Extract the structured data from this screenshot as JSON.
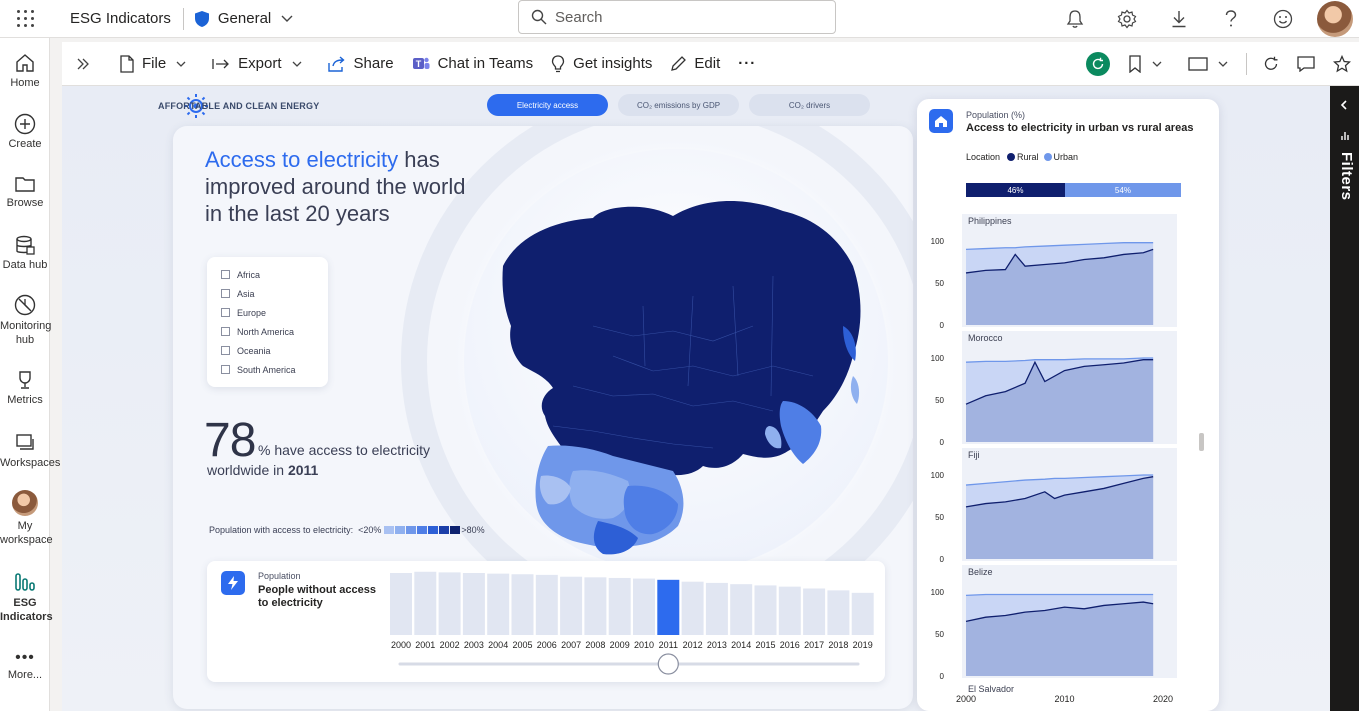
{
  "app": {
    "title": "ESG Indicators",
    "workspace": "General"
  },
  "search": {
    "placeholder": "Search"
  },
  "rail": [
    {
      "label": "Home",
      "icon": "home-icon"
    },
    {
      "label": "Create",
      "icon": "plus-circle-icon"
    },
    {
      "label": "Browse",
      "icon": "folder-icon"
    },
    {
      "label": "Data hub",
      "icon": "database-icon"
    },
    {
      "label": "Monitoring",
      "label2": "hub",
      "icon": "monitoring-icon"
    },
    {
      "label": "Metrics",
      "icon": "trophy-icon"
    },
    {
      "label": "Workspaces",
      "icon": "workspaces-icon"
    },
    {
      "label": "My",
      "label2": "workspace",
      "icon": "avatar"
    },
    {
      "label": "ESG",
      "label2": "Indicators",
      "icon": "bar-chart-icon"
    },
    {
      "label": "More...",
      "icon": "more-icon"
    }
  ],
  "toolbar": {
    "file": "File",
    "export": "Export",
    "share": "Share",
    "chat": "Chat in Teams",
    "insights": "Get insights",
    "edit": "Edit",
    "more": "···"
  },
  "filters": {
    "label": "Filters"
  },
  "report": {
    "section_title": "AFFORTABLE AND CLEAN ENERGY",
    "tabs": [
      {
        "label": "Electricity access",
        "active": true
      },
      {
        "label": "CO₂ emissions by GDP",
        "active": false
      },
      {
        "label": "CO₂ drivers",
        "active": false
      }
    ],
    "headline_highlight": "Access to electricity",
    "headline_rest1": " has",
    "headline_line2": "improved around the world",
    "headline_line3": "in the last 20 years",
    "regions": [
      "Africa",
      "Asia",
      "Europe",
      "North America",
      "Oceania",
      "South America"
    ],
    "big_number": "78",
    "big_number_desc": "% have access to electricity",
    "big_number_desc2_prefix": "worldwide in ",
    "big_number_year": "2011",
    "legend_label": "Population with access to electricity:",
    "legend_low": "<20%",
    "legend_high": ">80%",
    "legend_colors": [
      "#a9c1f2",
      "#8fb0ef",
      "#6f97ea",
      "#4f7ee6",
      "#2d5fd6",
      "#1c3fa8",
      "#0f2370"
    ],
    "colors": {
      "accent": "#2d6bee",
      "dark": "#0f1f6e"
    }
  },
  "population_card": {
    "subtitle": "Population",
    "title": "People without access to electricity",
    "selected_year": "2011",
    "years": [
      "2000",
      "2001",
      "2002",
      "2003",
      "2004",
      "2005",
      "2006",
      "2007",
      "2008",
      "2009",
      "2010",
      "2011",
      "2012",
      "2013",
      "2014",
      "2015",
      "2016",
      "2017",
      "2018",
      "2019"
    ],
    "values": [
      1.0,
      1.02,
      1.01,
      1.0,
      0.99,
      0.98,
      0.97,
      0.94,
      0.93,
      0.92,
      0.91,
      0.89,
      0.86,
      0.84,
      0.82,
      0.8,
      0.78,
      0.75,
      0.72,
      0.68
    ]
  },
  "urban_rural": {
    "subtitle": "Population (%)",
    "title": "Access to electricity in urban vs rural areas",
    "legend_title": "Location",
    "legend": [
      {
        "name": "Rural",
        "color": "#0f1f6e"
      },
      {
        "name": "Urban",
        "color": "#6f97ea"
      }
    ],
    "split": [
      {
        "label": "46%",
        "value": 46,
        "color": "#0f1f6e"
      },
      {
        "label": "54%",
        "value": 54,
        "color": "#6f97ea"
      }
    ],
    "y_ticks": [
      "100",
      "50",
      "0"
    ],
    "x_ticks": [
      "2000",
      "2010",
      "2020"
    ]
  },
  "chart_data": [
    {
      "type": "area",
      "title": "Philippines",
      "x": [
        2000,
        2002,
        2004,
        2005,
        2006,
        2008,
        2010,
        2012,
        2014,
        2016,
        2018,
        2019
      ],
      "series": [
        {
          "name": "Urban",
          "values": [
            90,
            91,
            92,
            92,
            93,
            94,
            95,
            96,
            97,
            98,
            98,
            98
          ]
        },
        {
          "name": "Rural",
          "values": [
            62,
            65,
            66,
            84,
            70,
            72,
            74,
            78,
            80,
            84,
            86,
            90
          ]
        }
      ],
      "ylim": [
        0,
        100
      ]
    },
    {
      "type": "area",
      "title": "Morocco",
      "x": [
        2000,
        2002,
        2004,
        2006,
        2007,
        2008,
        2010,
        2012,
        2014,
        2016,
        2018,
        2019
      ],
      "series": [
        {
          "name": "Urban",
          "values": [
            95,
            96,
            96,
            97,
            98,
            98,
            98,
            99,
            99,
            99,
            100,
            100
          ]
        },
        {
          "name": "Rural",
          "values": [
            45,
            55,
            60,
            70,
            95,
            72,
            85,
            90,
            92,
            94,
            98,
            98
          ]
        }
      ],
      "ylim": [
        0,
        100
      ]
    },
    {
      "type": "area",
      "title": "Fiji",
      "x": [
        2000,
        2002,
        2004,
        2006,
        2008,
        2009,
        2010,
        2012,
        2014,
        2016,
        2018,
        2019
      ],
      "series": [
        {
          "name": "Urban",
          "values": [
            88,
            90,
            92,
            94,
            95,
            96,
            96,
            97,
            98,
            99,
            100,
            100
          ]
        },
        {
          "name": "Rural",
          "values": [
            62,
            66,
            68,
            72,
            80,
            72,
            76,
            80,
            84,
            90,
            96,
            98
          ]
        }
      ],
      "ylim": [
        0,
        100
      ]
    },
    {
      "type": "area",
      "title": "Belize",
      "x": [
        2000,
        2002,
        2004,
        2006,
        2008,
        2010,
        2012,
        2014,
        2016,
        2018,
        2019
      ],
      "series": [
        {
          "name": "Urban",
          "values": [
            96,
            97,
            97,
            97,
            97,
            97,
            97,
            97,
            97,
            97,
            97
          ]
        },
        {
          "name": "Rural",
          "values": [
            65,
            70,
            72,
            76,
            78,
            82,
            80,
            84,
            86,
            88,
            86
          ]
        }
      ],
      "ylim": [
        0,
        100
      ]
    },
    {
      "type": "area",
      "title": "El Salvador",
      "x": [],
      "series": [],
      "ylim": [
        0,
        100
      ]
    }
  ]
}
